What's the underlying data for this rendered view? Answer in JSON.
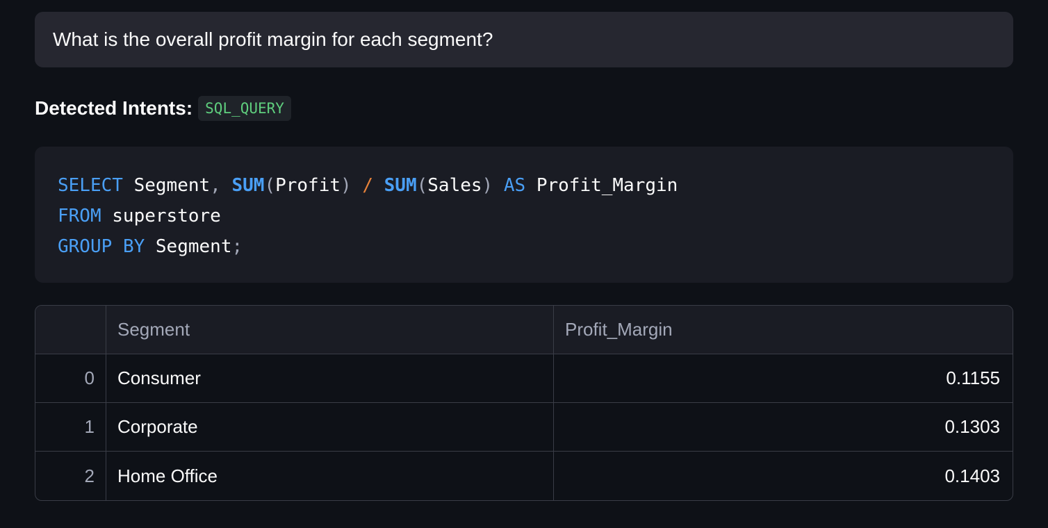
{
  "question": {
    "text": "What is the overall profit margin for each segment?"
  },
  "intents": {
    "label": "Detected Intents:",
    "badges": [
      "SQL_QUERY"
    ]
  },
  "code": {
    "language": "sql",
    "tokens": {
      "select": "SELECT",
      "segment_col": "Segment",
      "comma": ",",
      "sum1": "SUM",
      "lparen1": "(",
      "profit": "Profit",
      "rparen1": ")",
      "divide": "/",
      "sum2": "SUM",
      "lparen2": "(",
      "sales": "Sales",
      "rparen2": ")",
      "as": "AS",
      "alias": "Profit_Margin",
      "from": "FROM",
      "table": "superstore",
      "group": "GROUP",
      "by": "BY",
      "group_col": "Segment",
      "semicolon": ";"
    }
  },
  "table": {
    "columns": [
      "",
      "Segment",
      "Profit_Margin"
    ],
    "rows": [
      {
        "index": "0",
        "segment": "Consumer",
        "profit_margin": "0.1155"
      },
      {
        "index": "1",
        "segment": "Corporate",
        "profit_margin": "0.1303"
      },
      {
        "index": "2",
        "segment": "Home Office",
        "profit_margin": "0.1403"
      }
    ]
  }
}
